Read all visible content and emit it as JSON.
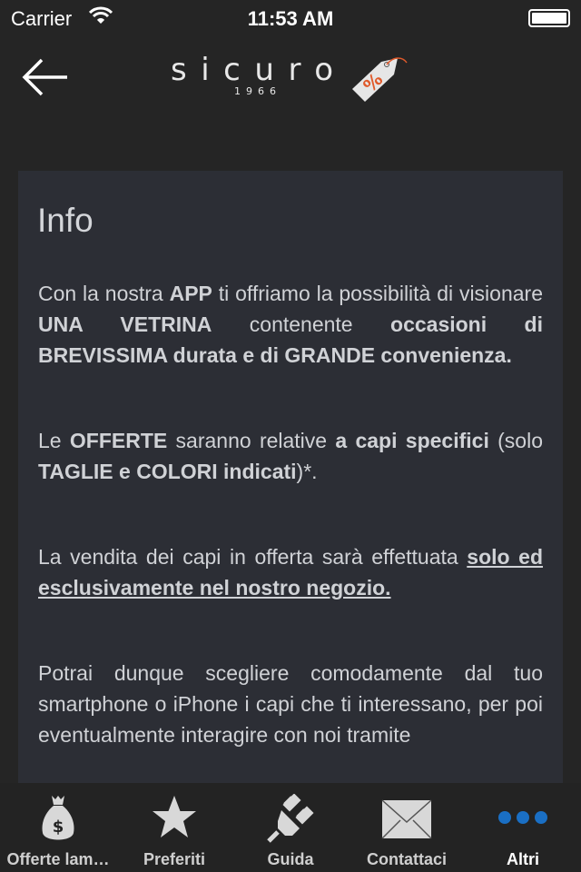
{
  "status_bar": {
    "carrier": "Carrier",
    "time": "11:53 AM"
  },
  "header": {
    "logo_text": "sicuro",
    "logo_year": "1966",
    "tag_symbol": "%"
  },
  "card": {
    "title": "Info",
    "paragraphs": [
      [
        {
          "t": "Con la nostra "
        },
        {
          "t": "APP",
          "b": true
        },
        {
          "t": " ti offriamo la possibilità di visionare "
        },
        {
          "t": "UNA VETRINA",
          "b": true
        },
        {
          "t": " contenente "
        },
        {
          "t": "occasioni di BREVISSIMA durata e di GRANDE convenienza.",
          "b": true
        }
      ],
      [
        {
          "t": "Le "
        },
        {
          "t": "OFFERTE",
          "b": true
        },
        {
          "t": " saranno relative "
        },
        {
          "t": "a capi specifici",
          "b": true
        },
        {
          "t": " (solo "
        },
        {
          "t": "TAGLIE e COLORI indicati",
          "b": true
        },
        {
          "t": ")*."
        }
      ],
      [
        {
          "t": "La vendita dei capi in offerta sarà effettuata "
        },
        {
          "t": "solo ed esclusivamente nel nostro negozio.",
          "u": true
        }
      ],
      [
        {
          "t": "Potrai dunque scegliere comodamente dal tuo smartphone o iPhone i capi che ti interessano, per poi eventualmente interagire con noi tramite"
        }
      ]
    ]
  },
  "tabbar": {
    "active_color": "#1a6fc4",
    "items": [
      {
        "label": "Offerte lam…",
        "icon": "money-bag-icon"
      },
      {
        "label": "Preferiti",
        "icon": "star-icon"
      },
      {
        "label": "Guida",
        "icon": "plug-icon"
      },
      {
        "label": "Contattaci",
        "icon": "envelope-icon"
      },
      {
        "label": "Altri",
        "icon": "more-dots-icon"
      }
    ]
  }
}
